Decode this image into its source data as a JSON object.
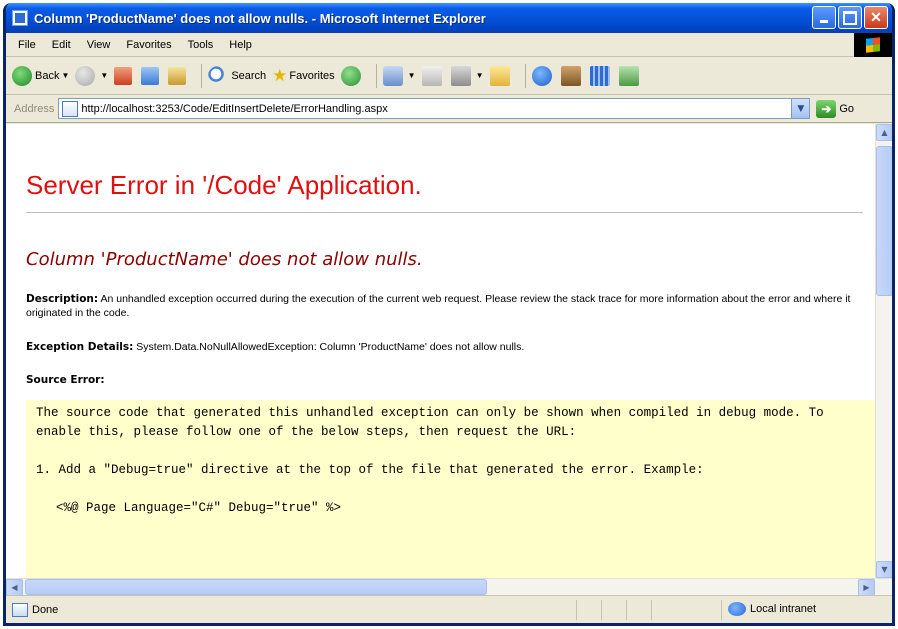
{
  "window": {
    "title": "Column 'ProductName' does not allow nulls. - Microsoft Internet Explorer"
  },
  "menu": {
    "items": [
      "File",
      "Edit",
      "View",
      "Favorites",
      "Tools",
      "Help"
    ]
  },
  "toolbar": {
    "back_label": "Back",
    "search_label": "Search",
    "favorites_label": "Favorites",
    "icons": [
      "back-icon",
      "forward-icon",
      "stop-icon",
      "refresh-icon",
      "home-icon",
      "search-icon",
      "favorites-icon",
      "media-icon",
      "history-icon",
      "mail-icon",
      "print-icon",
      "edit-icon",
      "folder-icon",
      "msn-icon",
      "tool-icon",
      "grid-icon",
      "extension-icon"
    ]
  },
  "address": {
    "label": "Address",
    "url": "http://localhost:3253/Code/EditInsertDelete/ErrorHandling.aspx",
    "go_label": "Go"
  },
  "page": {
    "error_title": "Server Error in '/Code' Application.",
    "error_subtitle": "Column 'ProductName' does not allow nulls.",
    "description_label": "Description:",
    "description_text": "An unhandled exception occurred during the execution of the current web request. Please review the stack trace for more information about the error and where it originated in the code.",
    "exception_label": "Exception Details:",
    "exception_text": "System.Data.NoNullAllowedException: Column 'ProductName' does not allow nulls.",
    "source_error_label": "Source Error:",
    "code_para1": "The source code that generated this unhandled exception can only be shown when compiled in debug mode. To enable this, please follow one of the below steps, then request the URL:",
    "code_para2": "1. Add a \"Debug=true\" directive at the top of the file that generated the error. Example:",
    "code_para3": "<%@ Page Language=\"C#\" Debug=\"true\" %>"
  },
  "status": {
    "text": "Done",
    "zone": "Local intranet"
  },
  "colors": {
    "error_title": "#E01010",
    "error_subtitle": "#8B0000",
    "code_background": "#FFFFCC",
    "titlebar": "#0553D9"
  }
}
